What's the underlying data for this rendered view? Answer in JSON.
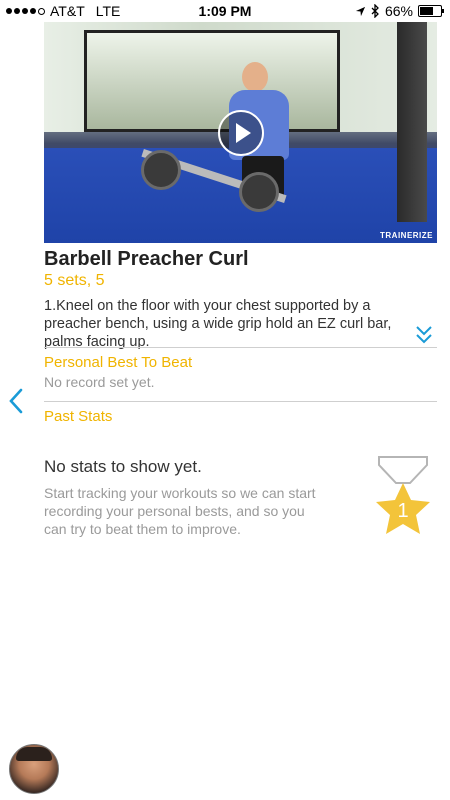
{
  "status_bar": {
    "carrier": "AT&T",
    "network": "LTE",
    "time": "1:09 PM",
    "battery": "66%",
    "battery_level": 0.66,
    "signal_bars_filled": 4,
    "signal_bars_total": 5,
    "icons": [
      "location-arrow-icon",
      "bluetooth-icon",
      "battery-icon"
    ]
  },
  "video": {
    "watermark": "TRAINERIZE",
    "play_icon": "play-icon"
  },
  "exercise": {
    "title": "Barbell Preacher Curl",
    "sets": "5 sets, 5",
    "description": "1.Kneel on the floor with your chest supported by a preacher bench, using a wide grip hold an EZ curl bar, palms facing up.",
    "expand_icon": "double-chevron-down-icon"
  },
  "personal_best": {
    "label": "Personal Best To Beat",
    "value": "No record set yet."
  },
  "past_stats": {
    "label": "Past Stats",
    "empty_title": "No stats to show yet.",
    "empty_body": "Start tracking your workouts so we can start recording your personal bests, and so you can try to beat them to improve.",
    "medal_number": "1"
  },
  "nav": {
    "back_icon": "chevron-left-icon"
  },
  "colors": {
    "accent": "#f0b400",
    "link_blue": "#1a9bd7",
    "text": "#333333",
    "muted": "#9a9a9a",
    "divider": "#cfcfcf"
  }
}
